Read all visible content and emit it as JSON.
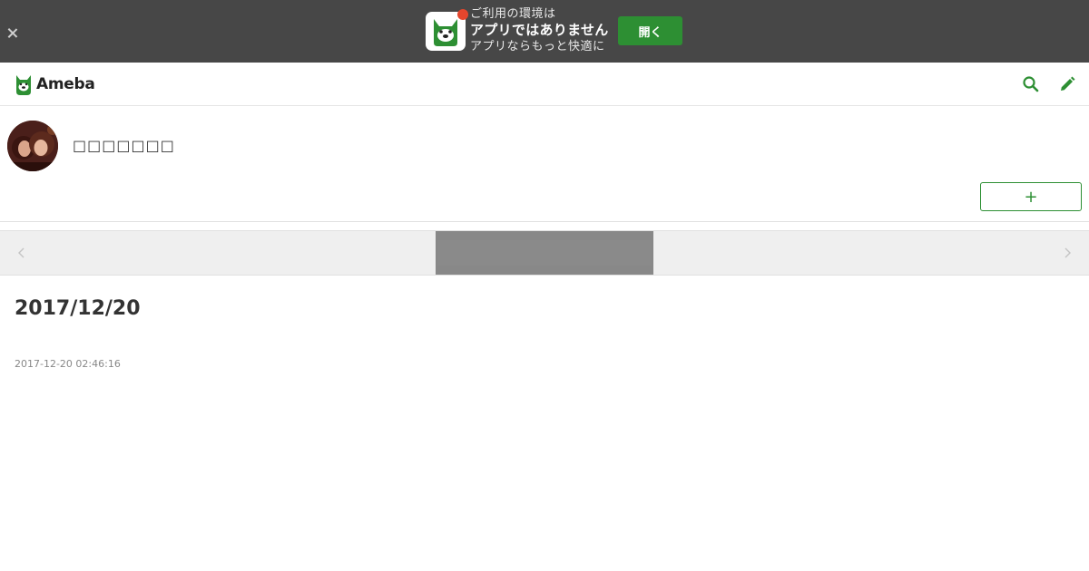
{
  "app_banner": {
    "line1": "ご利用の環境は",
    "line2": "アプリではありません",
    "line3": "アプリならもっと快適に",
    "open_button_label": "開く",
    "accent_color": "#2d8f33",
    "badge_color": "#e4462d"
  },
  "header": {
    "logo_text": "Ameba",
    "icons": [
      "search-icon",
      "pencil-icon"
    ]
  },
  "profile": {
    "blog_name": "□□□□□□□",
    "follow_button_label": "+"
  },
  "pager": {
    "prev_icon": "chevron-left-icon",
    "next_icon": "chevron-right-icon"
  },
  "entry": {
    "title": "2017/12/20",
    "datetime": "2017-12-20 02:46:16"
  }
}
